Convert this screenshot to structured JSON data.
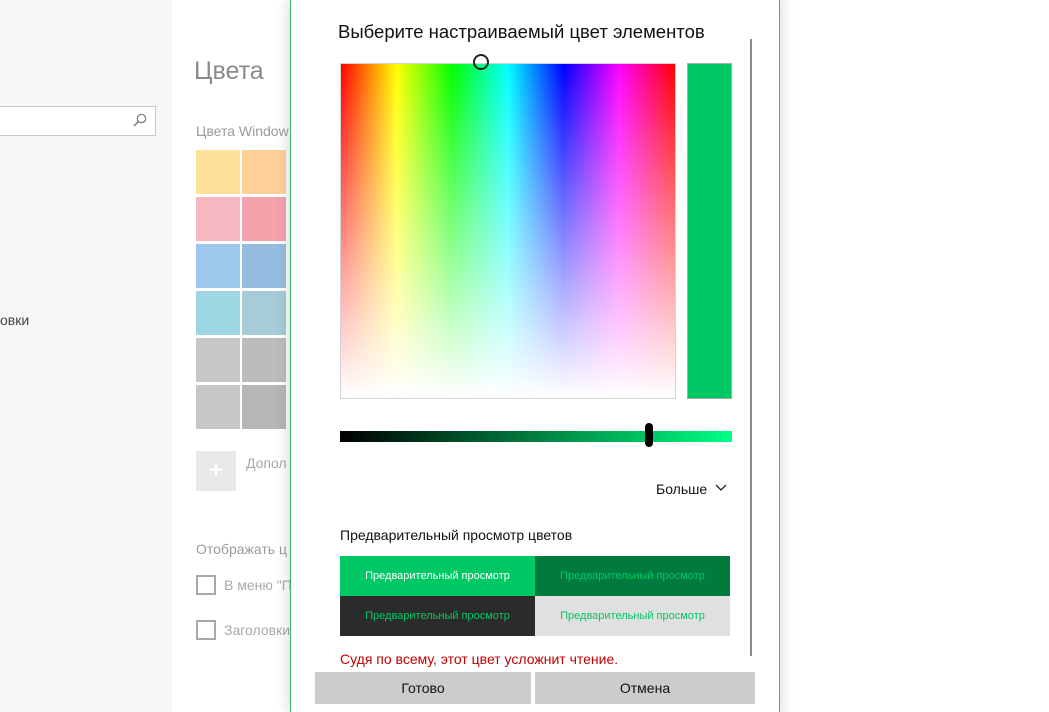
{
  "accent": "#00c864",
  "nav": {
    "search_placeholder": "",
    "search_icon": "search-icon",
    "item_label": "овки"
  },
  "settings": {
    "title": "Цвета",
    "section_label": "Цвета Window",
    "swatches": [
      [
        "#ffe199",
        "#ffd199"
      ],
      [
        "#f5b8c0",
        "#f3a3ab"
      ],
      [
        "#9dc8ec",
        "#96bde0"
      ],
      [
        "#9fd6e4",
        "#a8cbd8"
      ],
      [
        "#c6c6c6",
        "#bcbcbc"
      ],
      [
        "#c7c7c7",
        "#b6b6b6"
      ]
    ],
    "add_label": "Допол",
    "add_icon": "plus-icon",
    "show_label": "Отображать ц",
    "checkbox_start": "В меню \"П",
    "checkbox_titlebars": "Заголовки"
  },
  "dialog": {
    "title": "Выберите настраиваемый цвет элементов",
    "selected_color": "#00c864",
    "value_level": 0.79,
    "more_label": "Больше",
    "more_icon": "chevron-down-icon",
    "preview_heading": "Предварительный просмотр цветов",
    "previews": [
      {
        "text": "Предварительный просмотр",
        "bg": "#00c864",
        "fg": "#ffffff"
      },
      {
        "text": "Предварительный просмотр",
        "bg": "#007a3d",
        "fg": "#00c864"
      },
      {
        "text": "Предварительный просмотр",
        "bg": "#2b2b2b",
        "fg": "#00c864"
      },
      {
        "text": "Предварительный просмотр",
        "bg": "#e0e0e0",
        "fg": "#00c864"
      }
    ],
    "warning": "Судя по всему, этот цвет усложнит чтение.",
    "warning_color": "#c00000",
    "done_label": "Готово",
    "cancel_label": "Отмена"
  }
}
